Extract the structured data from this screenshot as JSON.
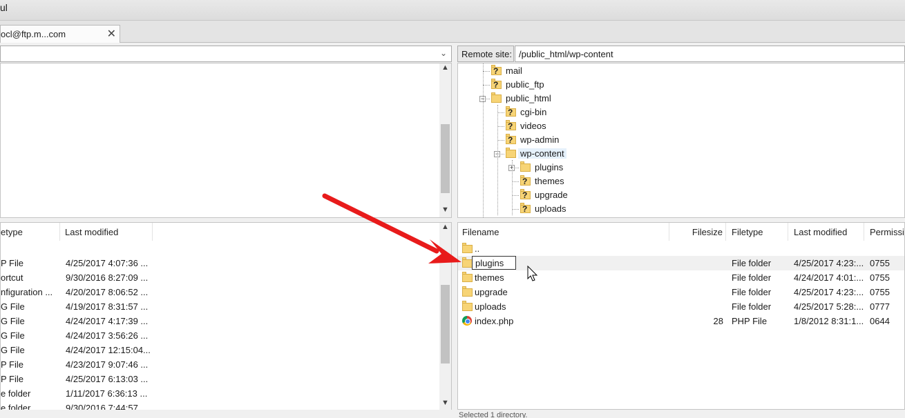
{
  "app": {
    "title_fragment": "ul"
  },
  "tab": {
    "label": "ocl@ftp.m...com",
    "close_glyph": "✕"
  },
  "local": {
    "dropdown_glyph": "⌄",
    "columns": {
      "filetype": "etype",
      "last_modified": "Last modified"
    },
    "rows": [
      {
        "type": "P File",
        "modified": "4/25/2017 4:07:36 ..."
      },
      {
        "type": "ortcut",
        "modified": "9/30/2016 8:27:09 ..."
      },
      {
        "type": "nfiguration ...",
        "modified": "4/20/2017 8:06:52 ..."
      },
      {
        "type": "G File",
        "modified": "4/19/2017 8:31:57 ..."
      },
      {
        "type": "G File",
        "modified": "4/24/2017 4:17:39 ..."
      },
      {
        "type": "G File",
        "modified": "4/24/2017 3:56:26 ..."
      },
      {
        "type": "G File",
        "modified": "4/24/2017 12:15:04..."
      },
      {
        "type": "P File",
        "modified": "4/23/2017 9:07:46 ..."
      },
      {
        "type": "P File",
        "modified": "4/25/2017 6:13:03 ..."
      },
      {
        "type": "e folder",
        "modified": "1/11/2017 6:36:13 ..."
      },
      {
        "type": "e folder",
        "modified": "9/30/2016 7:44:57 ..."
      }
    ]
  },
  "remote": {
    "label": "Remote site:",
    "path": "/public_html/wp-content",
    "tree": [
      {
        "name": "mail",
        "unknown": true
      },
      {
        "name": "public_ftp",
        "unknown": true
      },
      {
        "name": "public_html",
        "unknown": false,
        "expander": "−"
      },
      {
        "name": "cgi-bin",
        "unknown": true
      },
      {
        "name": "videos",
        "unknown": true
      },
      {
        "name": "wp-admin",
        "unknown": true
      },
      {
        "name": "wp-content",
        "unknown": false,
        "expander": "−"
      },
      {
        "name": "plugins",
        "unknown": false,
        "expander": "+"
      },
      {
        "name": "themes",
        "unknown": true
      },
      {
        "name": "upgrade",
        "unknown": true
      },
      {
        "name": "uploads",
        "unknown": true
      }
    ],
    "columns": {
      "filename": "Filename",
      "filesize": "Filesize",
      "filetype": "Filetype",
      "last_modified": "Last modified",
      "permissions": "Permissio"
    },
    "rows": [
      {
        "name": "..",
        "size": "",
        "type": "",
        "modified": "",
        "perm": ""
      },
      {
        "name": "plugins",
        "size": "",
        "type": "File folder",
        "modified": "4/25/2017 4:23:...",
        "perm": "0755"
      },
      {
        "name": "themes",
        "size": "",
        "type": "File folder",
        "modified": "4/24/2017 4:01:...",
        "perm": "0755"
      },
      {
        "name": "upgrade",
        "size": "",
        "type": "File folder",
        "modified": "4/25/2017 4:23:...",
        "perm": "0755"
      },
      {
        "name": "uploads",
        "size": "",
        "type": "File folder",
        "modified": "4/25/2017 5:28:...",
        "perm": "0777"
      },
      {
        "name": "index.php",
        "size": "28",
        "type": "PHP File",
        "modified": "1/8/2012 8:31:1...",
        "perm": "0644"
      }
    ],
    "status": "Selected 1 directory."
  },
  "colors": {
    "arrow": "#e81b1b",
    "folder": "#f7d476"
  }
}
